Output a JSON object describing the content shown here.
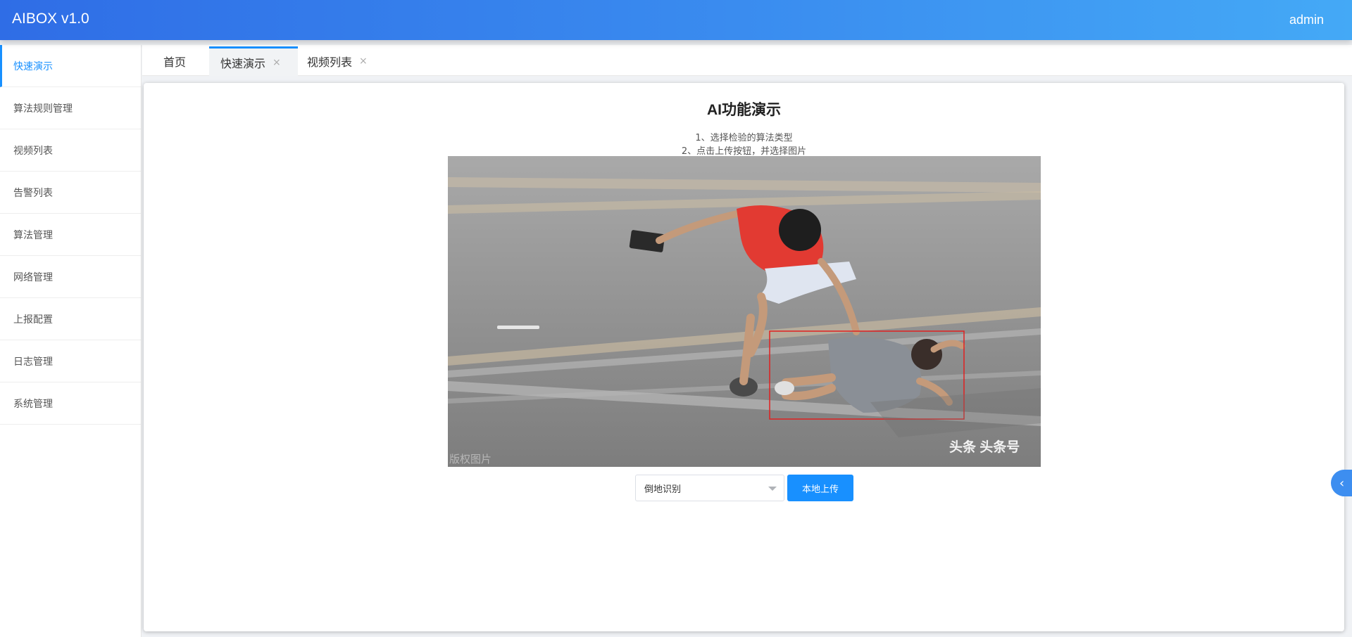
{
  "header": {
    "title": "AIBOX v1.0",
    "user": "admin"
  },
  "sidebar": {
    "items": [
      {
        "label": "快速演示",
        "active": true
      },
      {
        "label": "算法规则管理"
      },
      {
        "label": "视频列表"
      },
      {
        "label": "告警列表"
      },
      {
        "label": "算法管理"
      },
      {
        "label": "网络管理"
      },
      {
        "label": "上报配置"
      },
      {
        "label": "日志管理"
      },
      {
        "label": "系统管理"
      }
    ]
  },
  "tabs": [
    {
      "label": "首页"
    },
    {
      "label": "快速演示",
      "active": true,
      "close": "×"
    },
    {
      "label": "视频列表",
      "close": "×"
    }
  ],
  "demo": {
    "title": "AI功能演示",
    "step1": "1、选择检验的算法类型",
    "step2": "2、点击上传按钮，并选择图片",
    "image_watermark_left": "版权图片",
    "image_watermark_right": "头条 头条号",
    "algorithm_select": {
      "value": "倒地识别"
    },
    "upload_button": "本地上传"
  },
  "collapse_icon": "chevron-left",
  "colors": {
    "accent": "#1890ff",
    "header_start": "#2f6de6",
    "header_end": "#44a9f6",
    "detect_box": "#e02020"
  }
}
